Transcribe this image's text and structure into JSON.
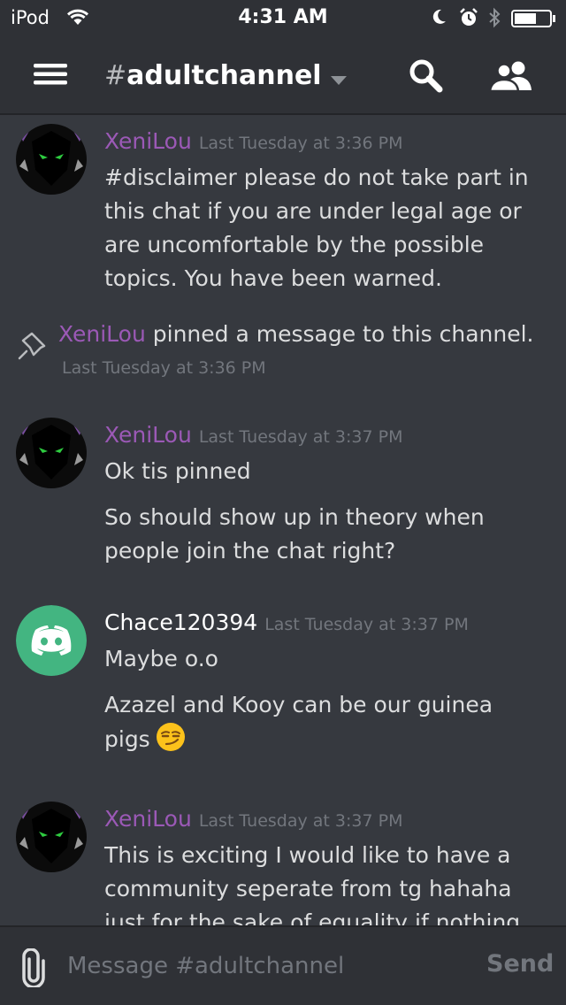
{
  "status_bar": {
    "carrier": "iPod",
    "time": "4:31 AM"
  },
  "nav": {
    "channel_hash": "#",
    "channel_name": "adultchannel",
    "icons": [
      "menu-icon",
      "chevron-down-icon",
      "search-icon",
      "members-icon"
    ]
  },
  "messages": [
    {
      "author": "XeniLou",
      "author_color": "#9b59b6",
      "timestamp": "Last Tuesday at 3:36 PM",
      "lines": [
        "#disclaimer please do not take part in this chat if you are under legal age or are uncomfortable by the possible topics. You have been warned."
      ]
    },
    {
      "author": "XeniLou",
      "author_color": "#9b59b6",
      "timestamp": "Last Tuesday at 3:37 PM",
      "lines": [
        "Ok tis pinned",
        "So should show up in theory when people join the chat right?"
      ]
    },
    {
      "author": "Chace120394",
      "author_color": "#ffffff",
      "timestamp": "Last Tuesday at 3:37 PM",
      "lines": [
        "Maybe o.o",
        "Azazel and Kooy can be our guinea pigs"
      ],
      "emoji": "smirk-emoji"
    },
    {
      "author": "XeniLou",
      "author_color": "#9b59b6",
      "timestamp": "Last Tuesday at 3:37 PM",
      "lines": [
        "This is exciting I would like to have a community seperate from tg hahaha just for the sake of equality if nothing"
      ]
    }
  ],
  "system_message": {
    "author": "XeniLou",
    "text": " pinned a message to this channel.",
    "timestamp": "Last Tuesday at 3:36 PM"
  },
  "composer": {
    "placeholder": "Message #adultchannel",
    "send_label": "Send"
  },
  "colors": {
    "background": "#36393f",
    "bar": "#2f3136",
    "username_purple": "#9b59b6",
    "muted": "#72767d",
    "discord_green": "#43b581"
  }
}
